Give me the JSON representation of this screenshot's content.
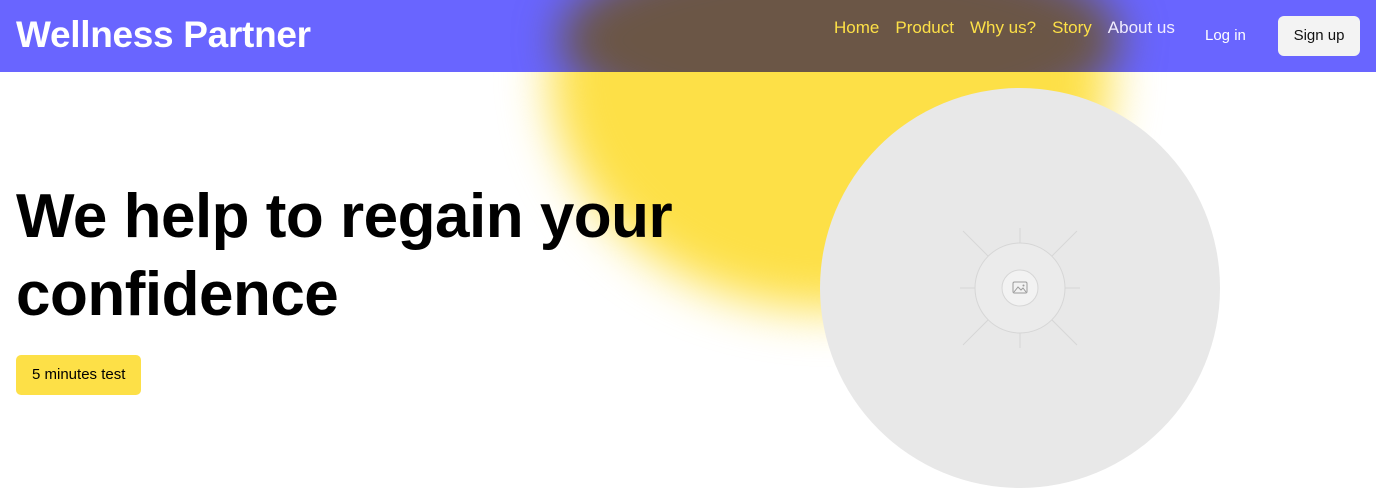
{
  "brand": {
    "name": "Wellness Partner"
  },
  "nav": {
    "links": [
      {
        "label": "Home"
      },
      {
        "label": "Product"
      },
      {
        "label": "Why us?"
      },
      {
        "label": "Story"
      },
      {
        "label": "About us"
      }
    ],
    "login_label": "Log in",
    "signup_label": "Sign up"
  },
  "hero": {
    "title_line1": "We help to regain your",
    "title_line2": "confidence",
    "cta_label": "5 minutes test",
    "image_icon": "image-icon"
  },
  "colors": {
    "navbar": "#635fff",
    "accent_yellow": "#fde047",
    "nav_link_yellow": "#fde047",
    "placeholder_gray": "#e8e8e8",
    "signup_bg": "#f3f3f3"
  }
}
